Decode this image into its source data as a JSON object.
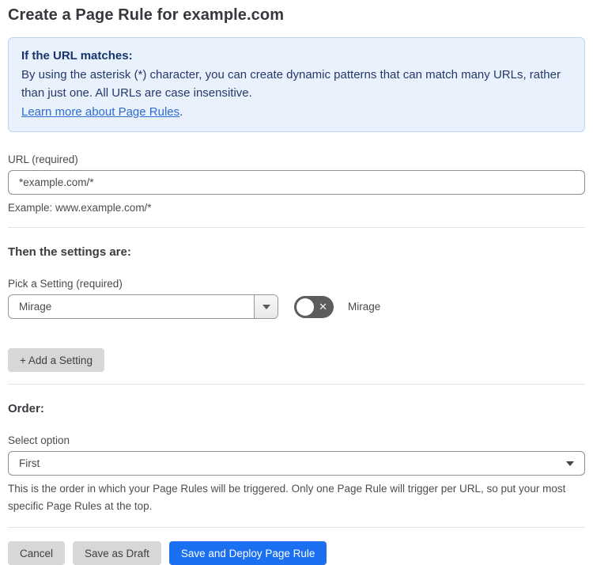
{
  "page": {
    "title": "Create a Page Rule for example.com"
  },
  "info_box": {
    "heading": "If the URL matches:",
    "body": "By using the asterisk (*) character, you can create dynamic patterns that can match many URLs, rather than just one. All URLs are case insensitive.",
    "link_text": "Learn more about Page Rules",
    "link_suffix": "."
  },
  "url_field": {
    "label": "URL (required)",
    "value": "*example.com/*",
    "helper": "Example: www.example.com/*"
  },
  "settings_section": {
    "heading": "Then the settings are:",
    "picker_label": "Pick a Setting (required)",
    "picker_value": "Mirage",
    "toggle_state": "off",
    "toggle_off_glyph": "✕",
    "toggle_label": "Mirage",
    "add_button_label": "+ Add a Setting"
  },
  "order_section": {
    "heading": "Order:",
    "select_label": "Select option",
    "select_value": "First",
    "helper": "This is the order in which your Page Rules will be triggered. Only one Page Rule will trigger per URL, so put your most specific Page Rules at the top."
  },
  "footer": {
    "cancel_label": "Cancel",
    "save_draft_label": "Save as Draft",
    "save_deploy_label": "Save and Deploy Page Rule"
  },
  "colors": {
    "info_bg": "#e9f2fc",
    "info_border": "#b9d6f2",
    "info_text": "#24386b",
    "link": "#2e6cd2",
    "primary_button": "#1a70f0",
    "gray_button": "#d7d7d7",
    "toggle_off_bg": "#5d5d5d"
  }
}
